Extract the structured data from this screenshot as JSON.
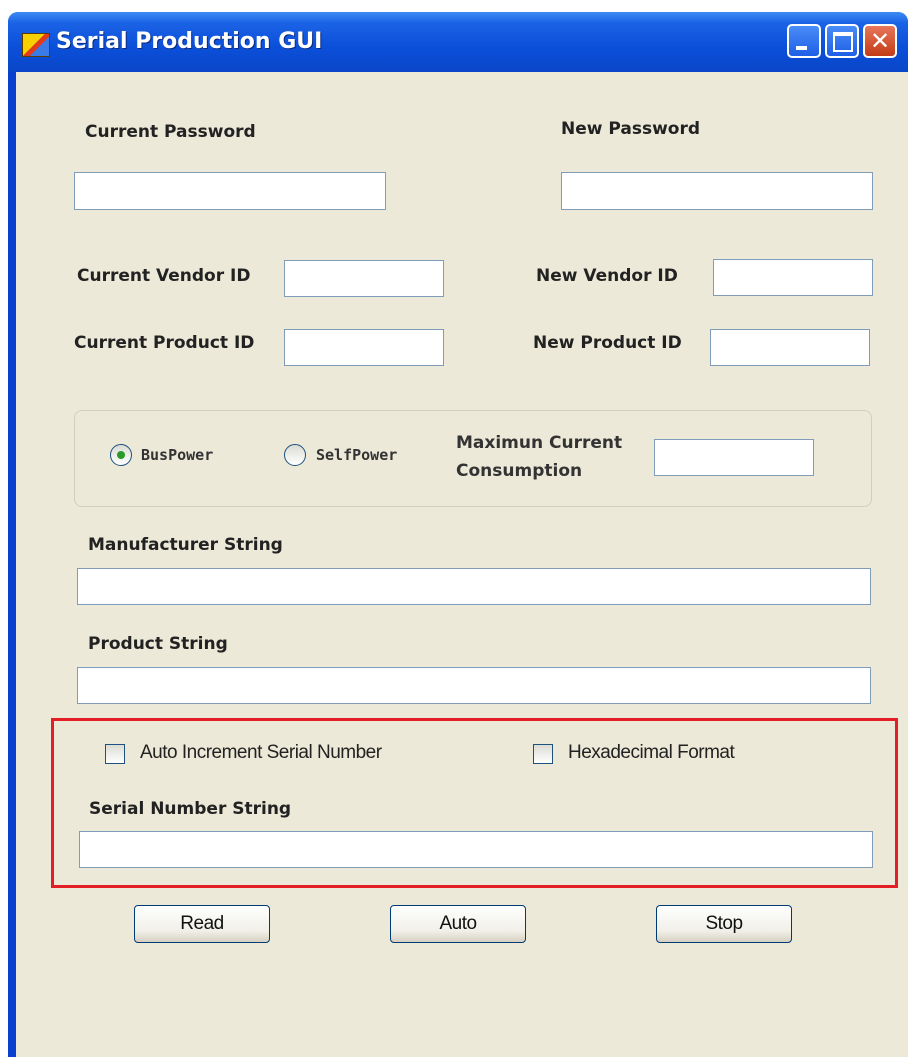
{
  "window": {
    "title": "Serial Production GUI",
    "controls": {
      "minimize": "minimize",
      "maximize": "maximize",
      "close": "✕"
    }
  },
  "password": {
    "current_label": "Current Password",
    "current_value": "",
    "new_label": "New Password",
    "new_value": ""
  },
  "vendor": {
    "current_label": "Current Vendor ID",
    "current_value": "",
    "new_label": "New Vendor ID",
    "new_value": ""
  },
  "product": {
    "current_label": "Current Product ID",
    "current_value": "",
    "new_label": "New Product ID",
    "new_value": ""
  },
  "power": {
    "options": [
      {
        "label": "BusPower",
        "selected": true
      },
      {
        "label": "SelfPower",
        "selected": false
      }
    ],
    "max_current_label_line1": "Maximun Current",
    "max_current_label_line2": "Consumption",
    "max_current_value": ""
  },
  "manufacturer": {
    "label": "Manufacturer String",
    "value": ""
  },
  "product_string": {
    "label": "Product String",
    "value": ""
  },
  "serial": {
    "auto_increment_label": "Auto Increment Serial Number",
    "auto_increment_checked": false,
    "hex_label": "Hexadecimal Format",
    "hex_checked": false,
    "label": "Serial Number String",
    "value": ""
  },
  "buttons": {
    "read": "Read",
    "auto": "Auto",
    "stop": "Stop"
  },
  "colors": {
    "title_bar": "#0b4fd9",
    "client_bg": "#ece9d8",
    "highlight_border": "#e41e26",
    "textbox_border": "#7f9db9"
  }
}
